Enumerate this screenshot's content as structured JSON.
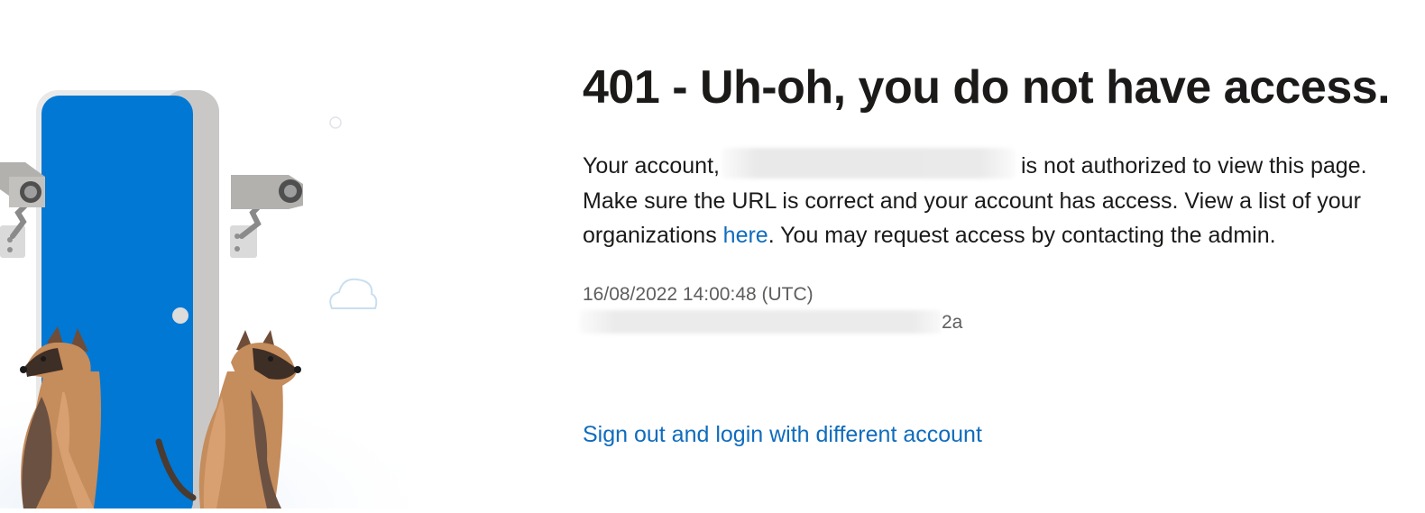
{
  "error": {
    "title": "401 - Uh-oh, you do not have access.",
    "message_part1": "Your account,",
    "message_part2": "is not authorized to view this page. Make sure the URL is correct and your account has access. View a list of your organizations",
    "here_link": "here",
    "message_part3": ". You may request access by contacting the admin."
  },
  "meta": {
    "timestamp": "16/08/2022 14:00:48 (UTC)",
    "activity_id_suffix": "2a"
  },
  "actions": {
    "sign_out_label": "Sign out and login with different account"
  },
  "colors": {
    "link": "#0f6cbd",
    "door": "#0078d4",
    "text": "#1b1a19",
    "muted": "#605e5c"
  },
  "icons": [
    "security-camera-icon",
    "guard-dog-icon",
    "door-icon",
    "cloud-icon"
  ]
}
